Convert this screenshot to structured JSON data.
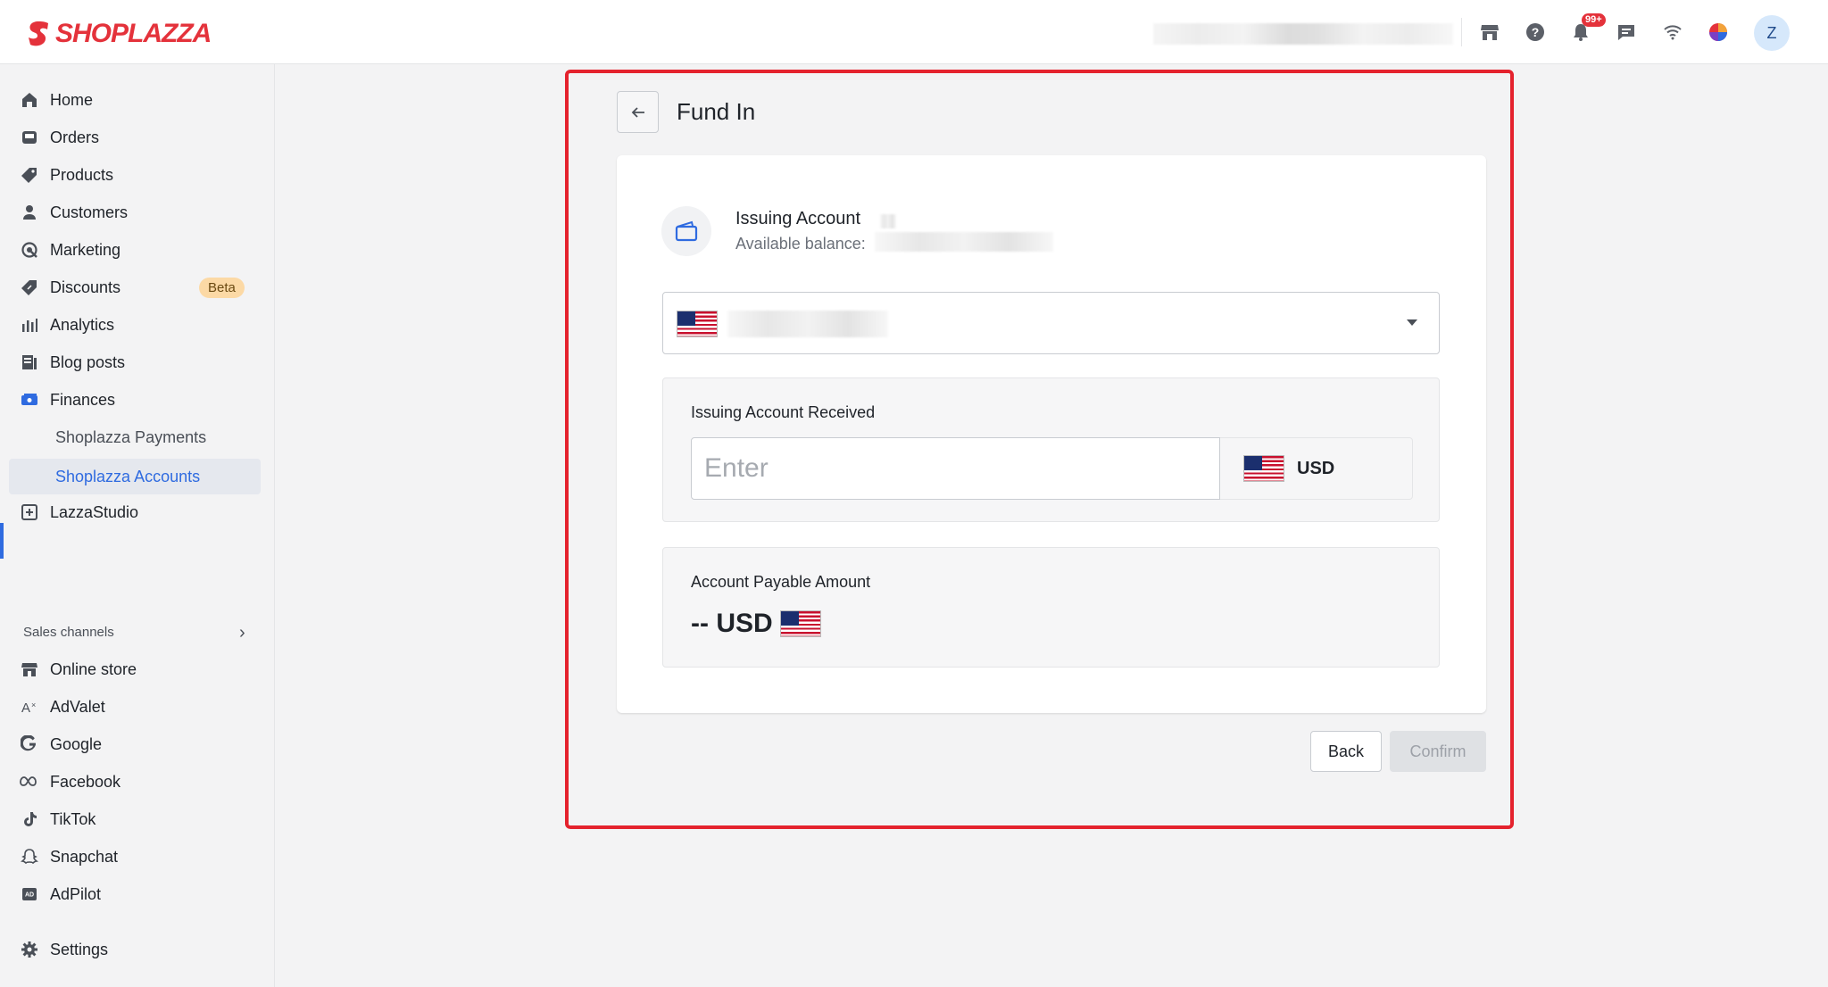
{
  "app": {
    "brand": "SHOPLAZZA",
    "notification_count": "99+",
    "user_initial": "Z"
  },
  "sidebar": {
    "items": [
      {
        "label": "Home",
        "icon": "home-icon"
      },
      {
        "label": "Orders",
        "icon": "inbox-icon"
      },
      {
        "label": "Products",
        "icon": "tag-icon"
      },
      {
        "label": "Customers",
        "icon": "person-icon"
      },
      {
        "label": "Marketing",
        "icon": "target-icon"
      },
      {
        "label": "Discounts",
        "icon": "discount-tag-icon",
        "badge": "Beta"
      },
      {
        "label": "Analytics",
        "icon": "bar-chart-icon"
      },
      {
        "label": "Blog posts",
        "icon": "document-icon"
      },
      {
        "label": "Finances",
        "icon": "finance-icon"
      },
      {
        "label": "Shoplazza Payments"
      },
      {
        "label": "Shoplazza Accounts",
        "active": true
      },
      {
        "label": "LazzaStudio",
        "icon": "image-edit-icon"
      }
    ],
    "sales_channels_title": "Sales channels",
    "channels": [
      {
        "label": "Online store",
        "icon": "store-icon"
      },
      {
        "label": "AdValet",
        "icon": "advalet-icon"
      },
      {
        "label": "Google",
        "icon": "google-icon"
      },
      {
        "label": "Facebook",
        "icon": "meta-icon"
      },
      {
        "label": "TikTok",
        "icon": "tiktok-icon"
      },
      {
        "label": "Snapchat",
        "icon": "snapchat-icon"
      },
      {
        "label": "AdPilot",
        "icon": "adpilot-icon"
      }
    ],
    "settings_label": "Settings"
  },
  "page": {
    "title": "Fund In",
    "issuing_account_title": "Issuing Account",
    "available_balance_label": "Available balance:",
    "received_label": "Issuing Account Received",
    "amount_placeholder": "Enter",
    "currency": "USD",
    "payable_label": "Account Payable Amount",
    "payable_value": "-- USD",
    "back_label": "Back",
    "confirm_label": "Confirm"
  },
  "colors": {
    "accent": "#2f6be0",
    "brand": "#e4323b",
    "highlight_border": "#e4222d"
  }
}
